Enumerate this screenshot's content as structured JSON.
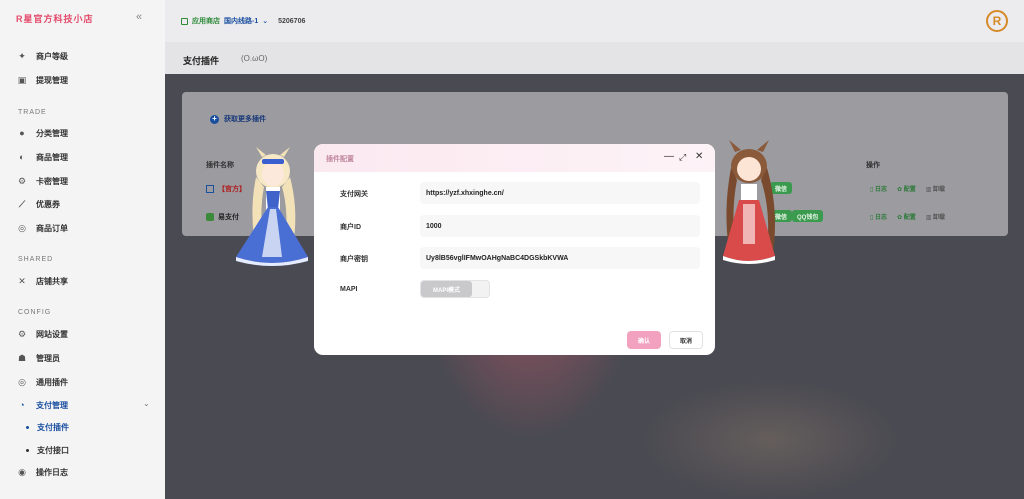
{
  "sidebar": {
    "brand": "R星官方科技小店",
    "collapse_icon": "double-chevron-left-icon",
    "items": [
      {
        "label": "商户等级",
        "icon": "rank-icon"
      },
      {
        "label": "提现管理",
        "icon": "wallet-icon"
      },
      {
        "label": "分类管理",
        "icon": "category-icon"
      },
      {
        "label": "商品管理",
        "icon": "goods-icon"
      },
      {
        "label": "卡密管理",
        "icon": "card-icon"
      },
      {
        "label": "优惠券",
        "icon": "coupon-icon"
      },
      {
        "label": "商品订单",
        "icon": "order-icon"
      },
      {
        "label": "店铺共享",
        "icon": "share-icon"
      },
      {
        "label": "网站设置",
        "icon": "settings-icon"
      },
      {
        "label": "管理员",
        "icon": "admin-icon"
      },
      {
        "label": "通用插件",
        "icon": "plugin-icon"
      },
      {
        "label": "支付管理",
        "icon": "payment-icon"
      },
      {
        "label": "支付插件",
        "icon": "dot"
      },
      {
        "label": "支付接口",
        "icon": "dot"
      },
      {
        "label": "操作日志",
        "icon": "log-icon"
      }
    ],
    "sections": [
      "TRADE",
      "SHARED",
      "CONFIG"
    ]
  },
  "topbar": {
    "store_label": "应用商店",
    "route": "国内线路-1",
    "code": "5206706",
    "avatar_letter": "R"
  },
  "page": {
    "title": "支付插件",
    "subtitle": "(O.ωO)"
  },
  "card": {
    "get_more": "获取更多插件",
    "col_name": "插件名称",
    "col_ops": "操作",
    "rows": [
      {
        "name": "【官方】",
        "tags": [
          "微信"
        ],
        "ops": [
          "日志",
          "配置",
          "卸载"
        ]
      },
      {
        "name": "易支付",
        "tags": [
          "微信",
          "QQ钱包"
        ],
        "ops": [
          "日志",
          "配置",
          "卸载"
        ]
      }
    ]
  },
  "modal": {
    "title": "插件配置",
    "fields": [
      {
        "label": "支付网关",
        "value": "https://yzf.xhxinghe.cn/"
      },
      {
        "label": "商户ID",
        "value": "1000"
      },
      {
        "label": "商户密钥",
        "value": "Uy8lB56vglIFMwOAHgNaBC4DGSkbKVWA"
      }
    ],
    "mapi_label": "MAPI",
    "mapi_switch": "MAPI模式",
    "ok": "确认",
    "cancel": "取消"
  }
}
